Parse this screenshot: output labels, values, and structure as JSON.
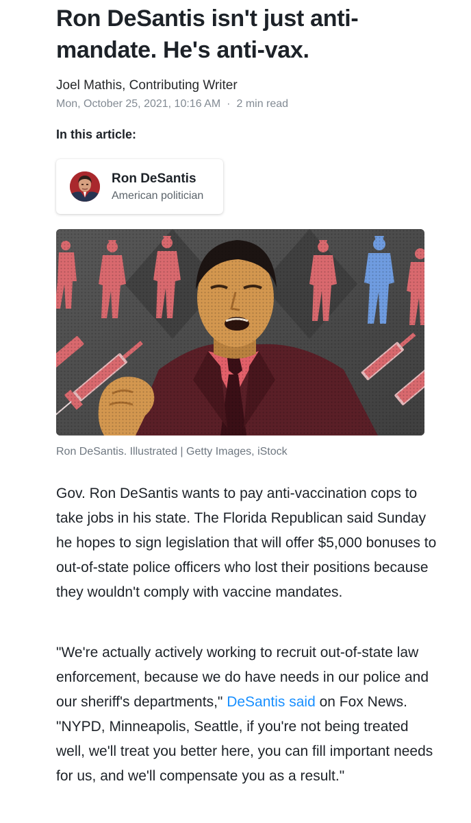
{
  "headline": "Ron DeSantis isn't just anti-mandate. He's anti-vax.",
  "byline": "Joel Mathis, Contributing Writer",
  "meta": {
    "date": "Mon, October 25, 2021, 10:16 AM",
    "separator": "·",
    "read_time": "2 min read"
  },
  "in_this_article": {
    "label": "In this article:",
    "entity_name": "Ron DeSantis",
    "entity_description": "American politician",
    "avatar_icon": "person-portrait-icon"
  },
  "hero_image": {
    "icon": "illustrated-photo-collage",
    "colors": {
      "background": "#4a4a4a",
      "red_figures": "#d9696e",
      "blue_figure": "#6f9ce0",
      "subject_skin": "#d3974f",
      "subject_shirt": "#e3606a",
      "subject_suit": "#5a1f27"
    }
  },
  "caption": "Ron DeSantis. Illustrated | Getty Images, iStock",
  "paragraphs": {
    "p1": "Gov. Ron DeSantis wants to pay anti-vaccination cops to take jobs in his state. The Florida Republican said Sunday he hopes to sign legislation that will offer $5,000 bonuses to out-of-state police officers who lost their positions because they wouldn't comply with vaccine mandates.",
    "p2_before_link": "\"We're actually actively working to recruit out-of-state law enforcement, because we do have needs in our police and our sheriff's departments,\" ",
    "p2_link": "DeSantis said",
    "p2_after_link": " on Fox News. \"NYPD, Minneapolis, Seattle, if you're not being treated well, we'll treat you better here, you can fill important needs for us, and we'll compensate you as a result.\""
  },
  "link_color": "#188fff"
}
